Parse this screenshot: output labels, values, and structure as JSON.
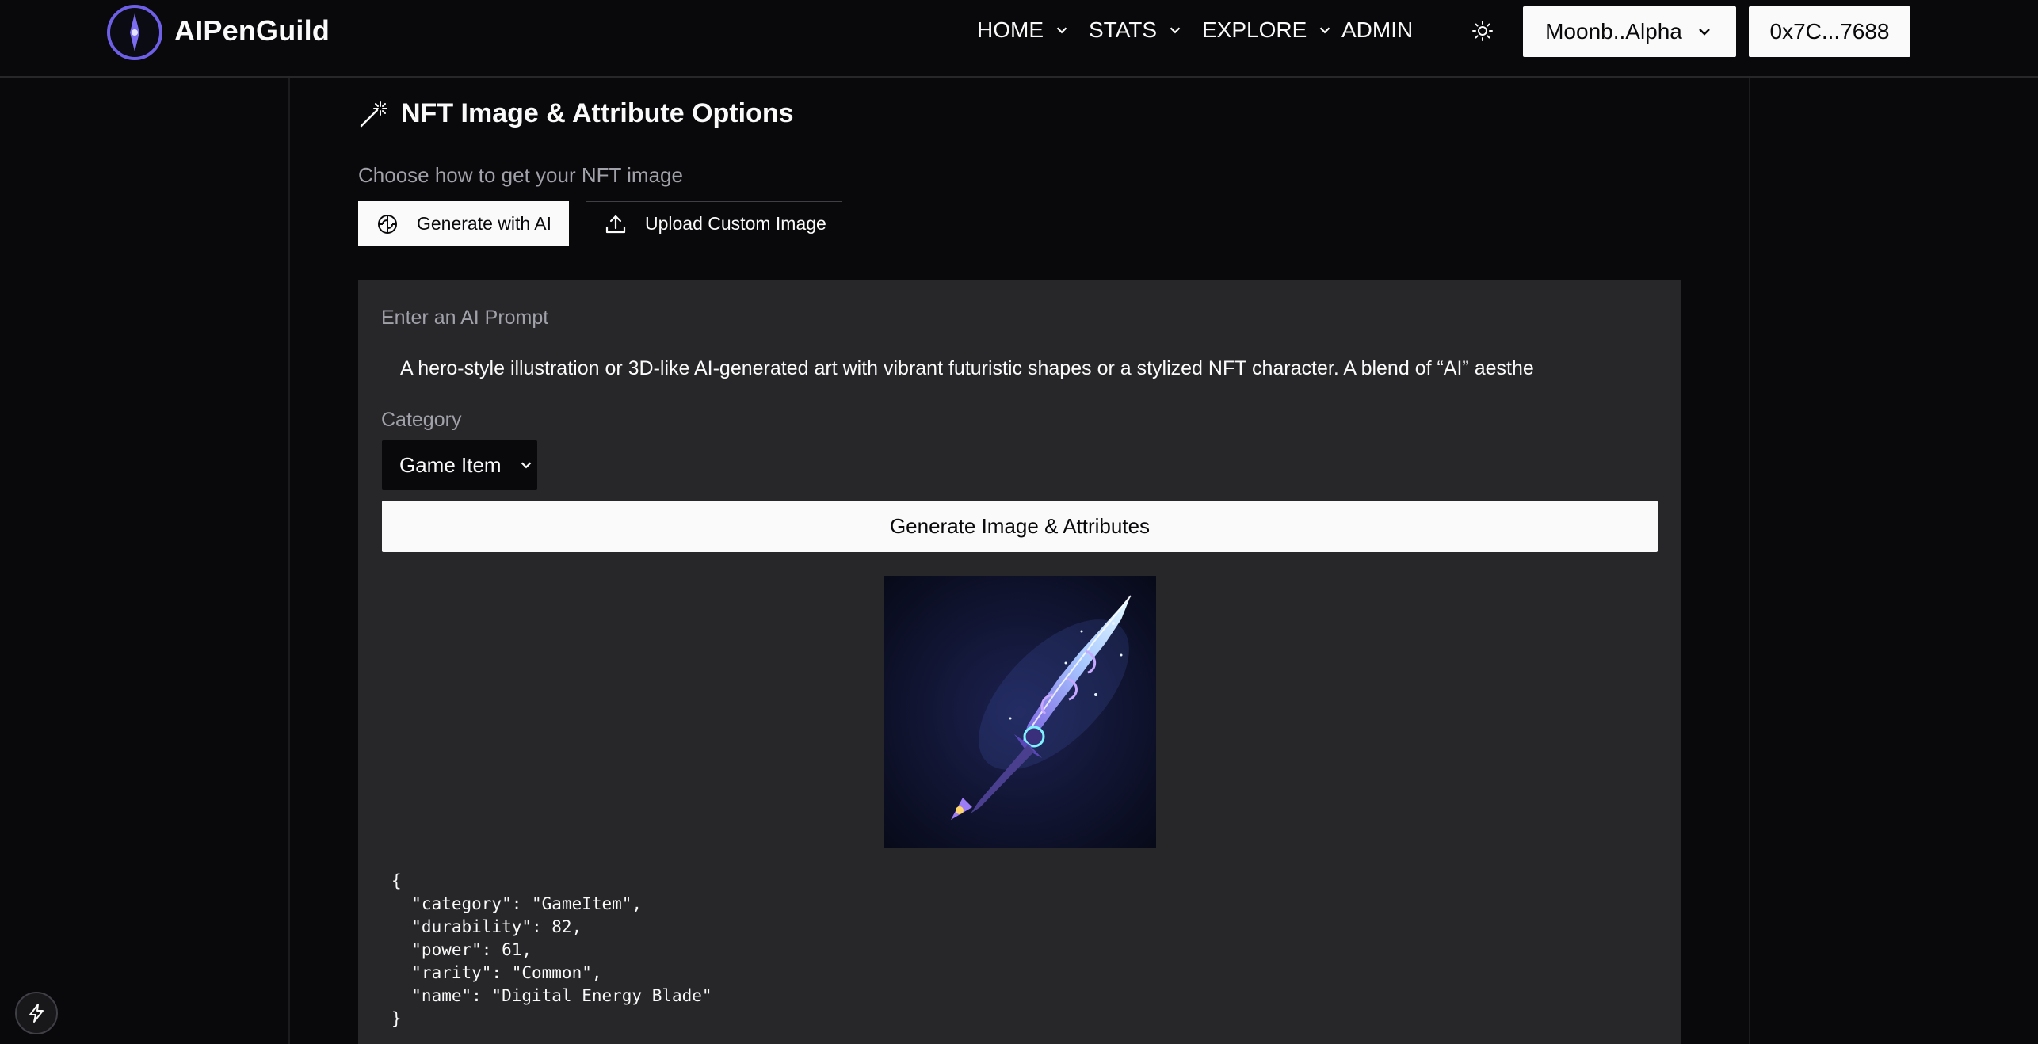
{
  "header": {
    "brand": "AIPenGuild",
    "nav": [
      {
        "label": "HOME"
      },
      {
        "label": "STATS"
      },
      {
        "label": "EXPLORE"
      },
      {
        "label": "ADMIN"
      }
    ],
    "network_label": "Moonb..Alpha",
    "wallet_label": "0x7C...7688"
  },
  "section": {
    "title": "NFT Image & Attribute Options",
    "subtitle": "Choose how to get your NFT image",
    "option_ai": "Generate with AI",
    "option_upload": "Upload Custom Image"
  },
  "form": {
    "prompt_label": "Enter an AI Prompt",
    "prompt_value": "A hero-style illustration or 3D-like AI-generated art with vibrant futuristic shapes or a stylized NFT character.  A blend of “AI” aesthe",
    "category_label": "Category",
    "category_value": "Game Item",
    "generate_label": "Generate Image & Attributes"
  },
  "result": {
    "json_text": "{\n  \"category\": \"GameItem\",\n  \"durability\": 82,\n  \"power\": 61,\n  \"rarity\": \"Common\",\n  \"name\": \"Digital Energy Blade\"\n}"
  },
  "icons": {
    "logo": "compass-logo-icon",
    "theme": "sun-icon",
    "section": "magic-wand-icon",
    "ai": "brain-icon",
    "upload": "upload-icon",
    "dev": "bolt-icon"
  },
  "colors": {
    "background": "#09090b",
    "panel": "#27272a",
    "accent": "#7c6cf0",
    "button_light": "#fafafa"
  }
}
